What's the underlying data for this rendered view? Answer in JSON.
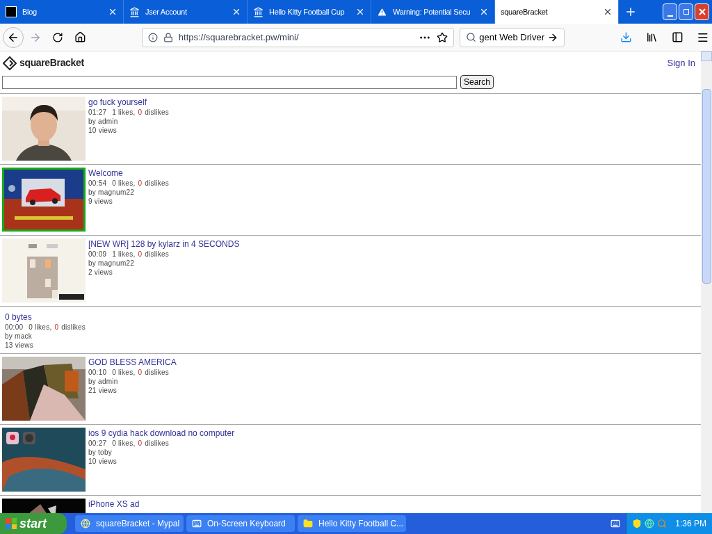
{
  "browser_tabs": [
    {
      "title": "Blog",
      "selected": false
    },
    {
      "title": "Jser Account",
      "selected": false
    },
    {
      "title": "Hello Kitty Football Cup",
      "selected": false
    },
    {
      "title": "Warning: Potential Secu",
      "selected": false
    },
    {
      "title": "squareBracket",
      "selected": true
    }
  ],
  "address_bar": {
    "url": "https://squarebracket.pw/mini/"
  },
  "search_bar": {
    "value": "gent Web Driver"
  },
  "site": {
    "logo": "squareBracket",
    "sign_in": "Sign In",
    "search_button": "Search"
  },
  "videos": [
    {
      "kind": "picture",
      "title": "go fuck yourself",
      "duration": "01:27",
      "likes": "1 likes,",
      "dislikes_count": "0",
      "dislikes_label": "dislikes",
      "author": "by admin",
      "views": "10 views"
    },
    {
      "kind": "picture",
      "title": "Welcome",
      "duration": "00:54",
      "likes": "0 likes,",
      "dislikes_count": "0",
      "dislikes_label": "dislikes",
      "author": "by magnum22",
      "views": "9 views"
    },
    {
      "kind": "picture",
      "title": "[NEW WR] 128 by kylarz in 4 SECONDS",
      "duration": "00:09",
      "likes": "1 likes,",
      "dislikes_count": "0",
      "dislikes_label": "dislikes",
      "author": "by magnum22",
      "views": "2 views"
    },
    {
      "kind": "text",
      "title": "0 bytes",
      "duration": "00:00",
      "likes": "0 likes,",
      "dislikes_count": "0",
      "dislikes_label": "dislikes",
      "author": "by mack",
      "views": "13 views"
    },
    {
      "kind": "picture",
      "title": "GOD BLESS AMERICA",
      "duration": "00:10",
      "likes": "0 likes,",
      "dislikes_count": "0",
      "dislikes_label": "dislikes",
      "author": "by admin",
      "views": "21 views"
    },
    {
      "kind": "picture",
      "title": "ios 9 cydia hack download no computer",
      "duration": "00:27",
      "likes": "0 likes,",
      "dislikes_count": "0",
      "dislikes_label": "dislikes",
      "author": "by toby",
      "views": "10 views"
    },
    {
      "kind": "picture",
      "title": "iPhone XS ad"
    }
  ],
  "taskbar": {
    "start": "start",
    "items": [
      {
        "label": "squareBracket - Mypal"
      },
      {
        "label": "On-Screen Keyboard"
      },
      {
        "label": "Hello Kitty Football C..."
      }
    ],
    "clock": "1:36 PM"
  }
}
